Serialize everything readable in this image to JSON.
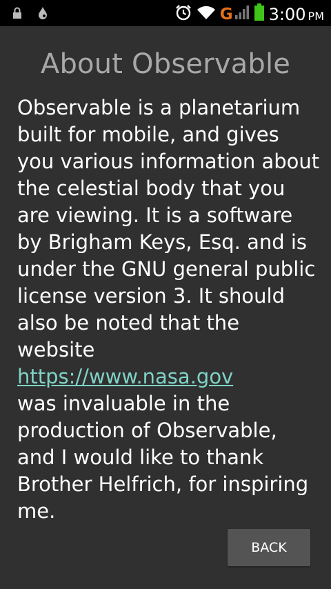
{
  "status_bar": {
    "network_label": "G",
    "time": "3:00",
    "ampm": "PM",
    "icons": [
      "lock-icon",
      "drop-icon",
      "alarm-icon",
      "wifi-icon",
      "signal-icon",
      "battery-icon"
    ],
    "colors": {
      "battery": "#3fc41a",
      "network": "#e5701a"
    }
  },
  "page": {
    "title": "About Observable",
    "paragraph_1": "Observable is a planetarium built for mobile, and gives you various information about the celestial body that you are viewing. It is a software by Brigham Keys, Esq. and is under the GNU general public license version 3. It should also be noted that the website",
    "link": "https://www.nasa.gov",
    "paragraph_2": " was invaluable in the production of Observable, and I would like to thank Brother Helfrich, for inspiring me."
  },
  "back_button": {
    "label": "BACK"
  },
  "colors": {
    "background": "#303030",
    "title": "#a8a8a8",
    "link": "#7fd3c6"
  }
}
